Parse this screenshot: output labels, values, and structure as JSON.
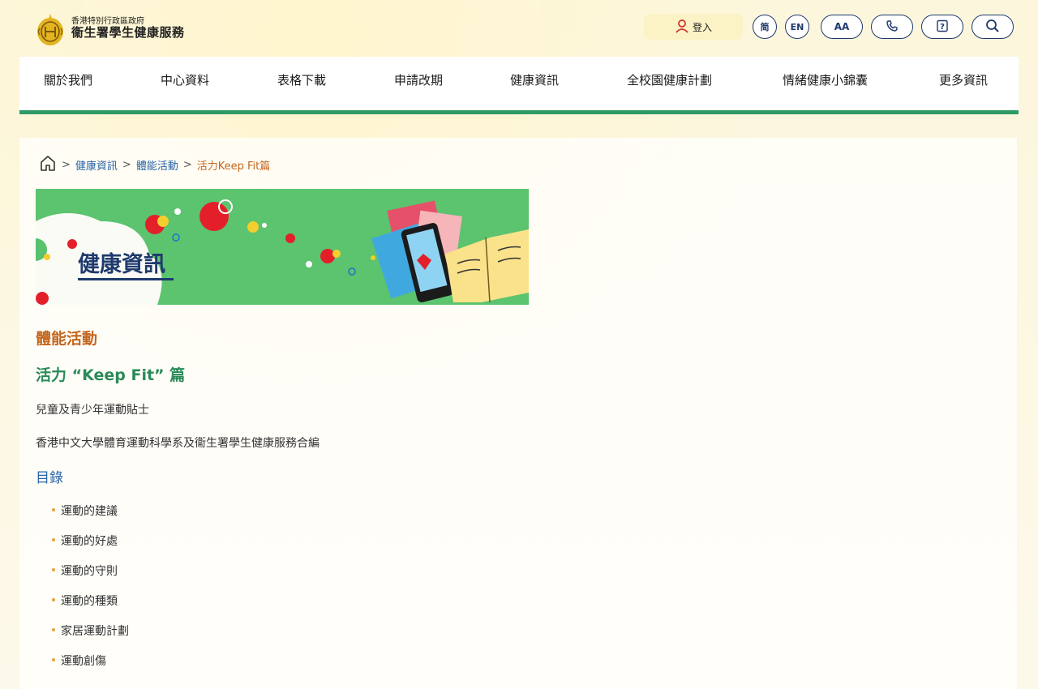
{
  "header": {
    "logo_small": "香港特別行政區政府",
    "logo_big": "衞生署學生健康服務",
    "login_label": "登入",
    "lang_sc": "简",
    "lang_en": "EN",
    "font_size_label": "AA",
    "icons": [
      "user-icon",
      "phone-icon",
      "help-icon",
      "search-icon"
    ]
  },
  "nav": {
    "items": [
      {
        "label": "關於我們"
      },
      {
        "label": "中心資料"
      },
      {
        "label": "表格下載"
      },
      {
        "label": "申請改期"
      },
      {
        "label": "健康資訊"
      },
      {
        "label": "全校園健康計劃"
      },
      {
        "label": "情緒健康小錦囊"
      },
      {
        "label": "更多資訊"
      }
    ]
  },
  "breadcrumb": {
    "items": [
      "健康資訊",
      "體能活動"
    ],
    "current": "活力Keep Fit篇",
    "separator": ">"
  },
  "banner": {
    "title": "健康資訊"
  },
  "content": {
    "section_title": "體能活動",
    "sub_title": "活力 “Keep Fit” 篇",
    "para1": "兒童及青少年運動貼士",
    "para2": "香港中文大學體育運動科學系及衞生署學生健康服務合編",
    "toc_title": "目錄",
    "toc": [
      "運動的建議",
      "運動的好處",
      "運動的守則",
      "運動的種類",
      "家居運動計劃",
      "運動創傷"
    ]
  },
  "colors": {
    "accent_green": "#2e9a66",
    "link_blue": "#2a64a8",
    "highlight_orange": "#c4651d",
    "banner_green": "#5cc36f"
  }
}
